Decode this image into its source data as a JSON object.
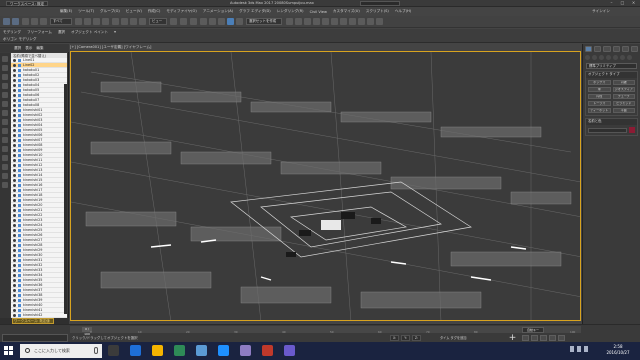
{
  "window": {
    "workspace": "ワークスペース: 既定",
    "title": "Autodesk 3ds Max 2017    20080Sumpuijou.max",
    "controls": [
      "–",
      "□",
      "×"
    ]
  },
  "menu": {
    "items": [
      "編集(E)",
      "ツール(T)",
      "グループ(G)",
      "ビュー(V)",
      "作成(C)",
      "モディファイヤ(O)",
      "アニメーション(A)",
      "グラフ エディタ(D)",
      "レンダリング(R)",
      "Civil View",
      "カスタマイズ(U)",
      "スクリプト(S)",
      "ヘルプ(H)"
    ],
    "sign_in": "サインイン"
  },
  "toolbar": {
    "filter": "すべて",
    "view": "ビュー",
    "selection_set": "選択セットを作成"
  },
  "ribbon": {
    "row1": [
      "モデリング",
      "フリーフォーム",
      "選択",
      "オブジェクト ペイント",
      "▾"
    ],
    "row2": [
      "ポリゴン モデリング"
    ]
  },
  "scene_explorer": {
    "tabs": [
      "選択",
      "表示",
      "編集"
    ],
    "header": "名前(昇順で並べ替え)",
    "items": [
      "Line01",
      "Line02",
      "kakoku01",
      "kakoku02",
      "kakoku03",
      "kakoku04",
      "kakoku05",
      "kakoku06",
      "kakoku07",
      "kakoku08",
      "kinenishi01",
      "kinenishi02",
      "kinenishi03",
      "kinenishi04",
      "kinenishi05",
      "kinenishi06",
      "kinenishi07",
      "kinenishi08",
      "kinenishi09",
      "kinenishi10",
      "kinenishi11",
      "kinenishi12",
      "kinenishi13",
      "kinenishi14",
      "kinenishi15",
      "kinenishi16",
      "kinenishi17",
      "kinenishi18",
      "kinenishi19",
      "kinenishi20",
      "kinenishi21",
      "kinenishi22",
      "kinenishi23",
      "kinenishi24",
      "kinenishi25",
      "kinenishi26",
      "kinenishi27",
      "kinenishi28",
      "kinenishi29",
      "kinenishi30",
      "kinenishi31",
      "kinenishi32",
      "kinenishi33",
      "kinenishi34",
      "kinenishi35",
      "kinenishi36",
      "kinenishi37",
      "kinenishi38",
      "kinenishi39",
      "kinenishi40",
      "kinenishi41",
      "kinenishi42"
    ],
    "selected_index": 1,
    "workspace_footer": "ワークスペース: 既定値"
  },
  "viewport": {
    "label": "[+] [Camera001] [ユーザ定義] [ワイヤフレーム]"
  },
  "command_panel": {
    "category": "標準プリミティブ",
    "rollout_type": "オブジェクト タイプ",
    "buttons": [
      "ボックス",
      "円錐",
      "球",
      "ジオスフィア",
      "円柱",
      "チューブ",
      "トーラス",
      "ピラミッド",
      "ティーポット",
      "平面"
    ],
    "rollout_name": "名前と色",
    "name_value": ""
  },
  "status": {
    "message": "クリック/ドラッグしてオブジェクトを選択",
    "frame": "0 / 100",
    "ticks": [
      "0",
      "10",
      "20",
      "30",
      "40",
      "50",
      "60",
      "70",
      "80",
      "90",
      "100"
    ],
    "coords": [
      "X:",
      "Y:",
      "Z:"
    ],
    "add_time_tag": "タイム タグを追加",
    "auto_key": "自動キー"
  },
  "taskbar": {
    "search_placeholder": "ここに入力して検索",
    "time": "2:58",
    "date": "2016/10/27",
    "app_colors": [
      "#3b3b3b",
      "#1e6fd8",
      "#f4b400",
      "#2e8b57",
      "#5b9bd5",
      "#1e90ff",
      "#8e7cc3",
      "#c0392b",
      "#6a5acd"
    ]
  }
}
